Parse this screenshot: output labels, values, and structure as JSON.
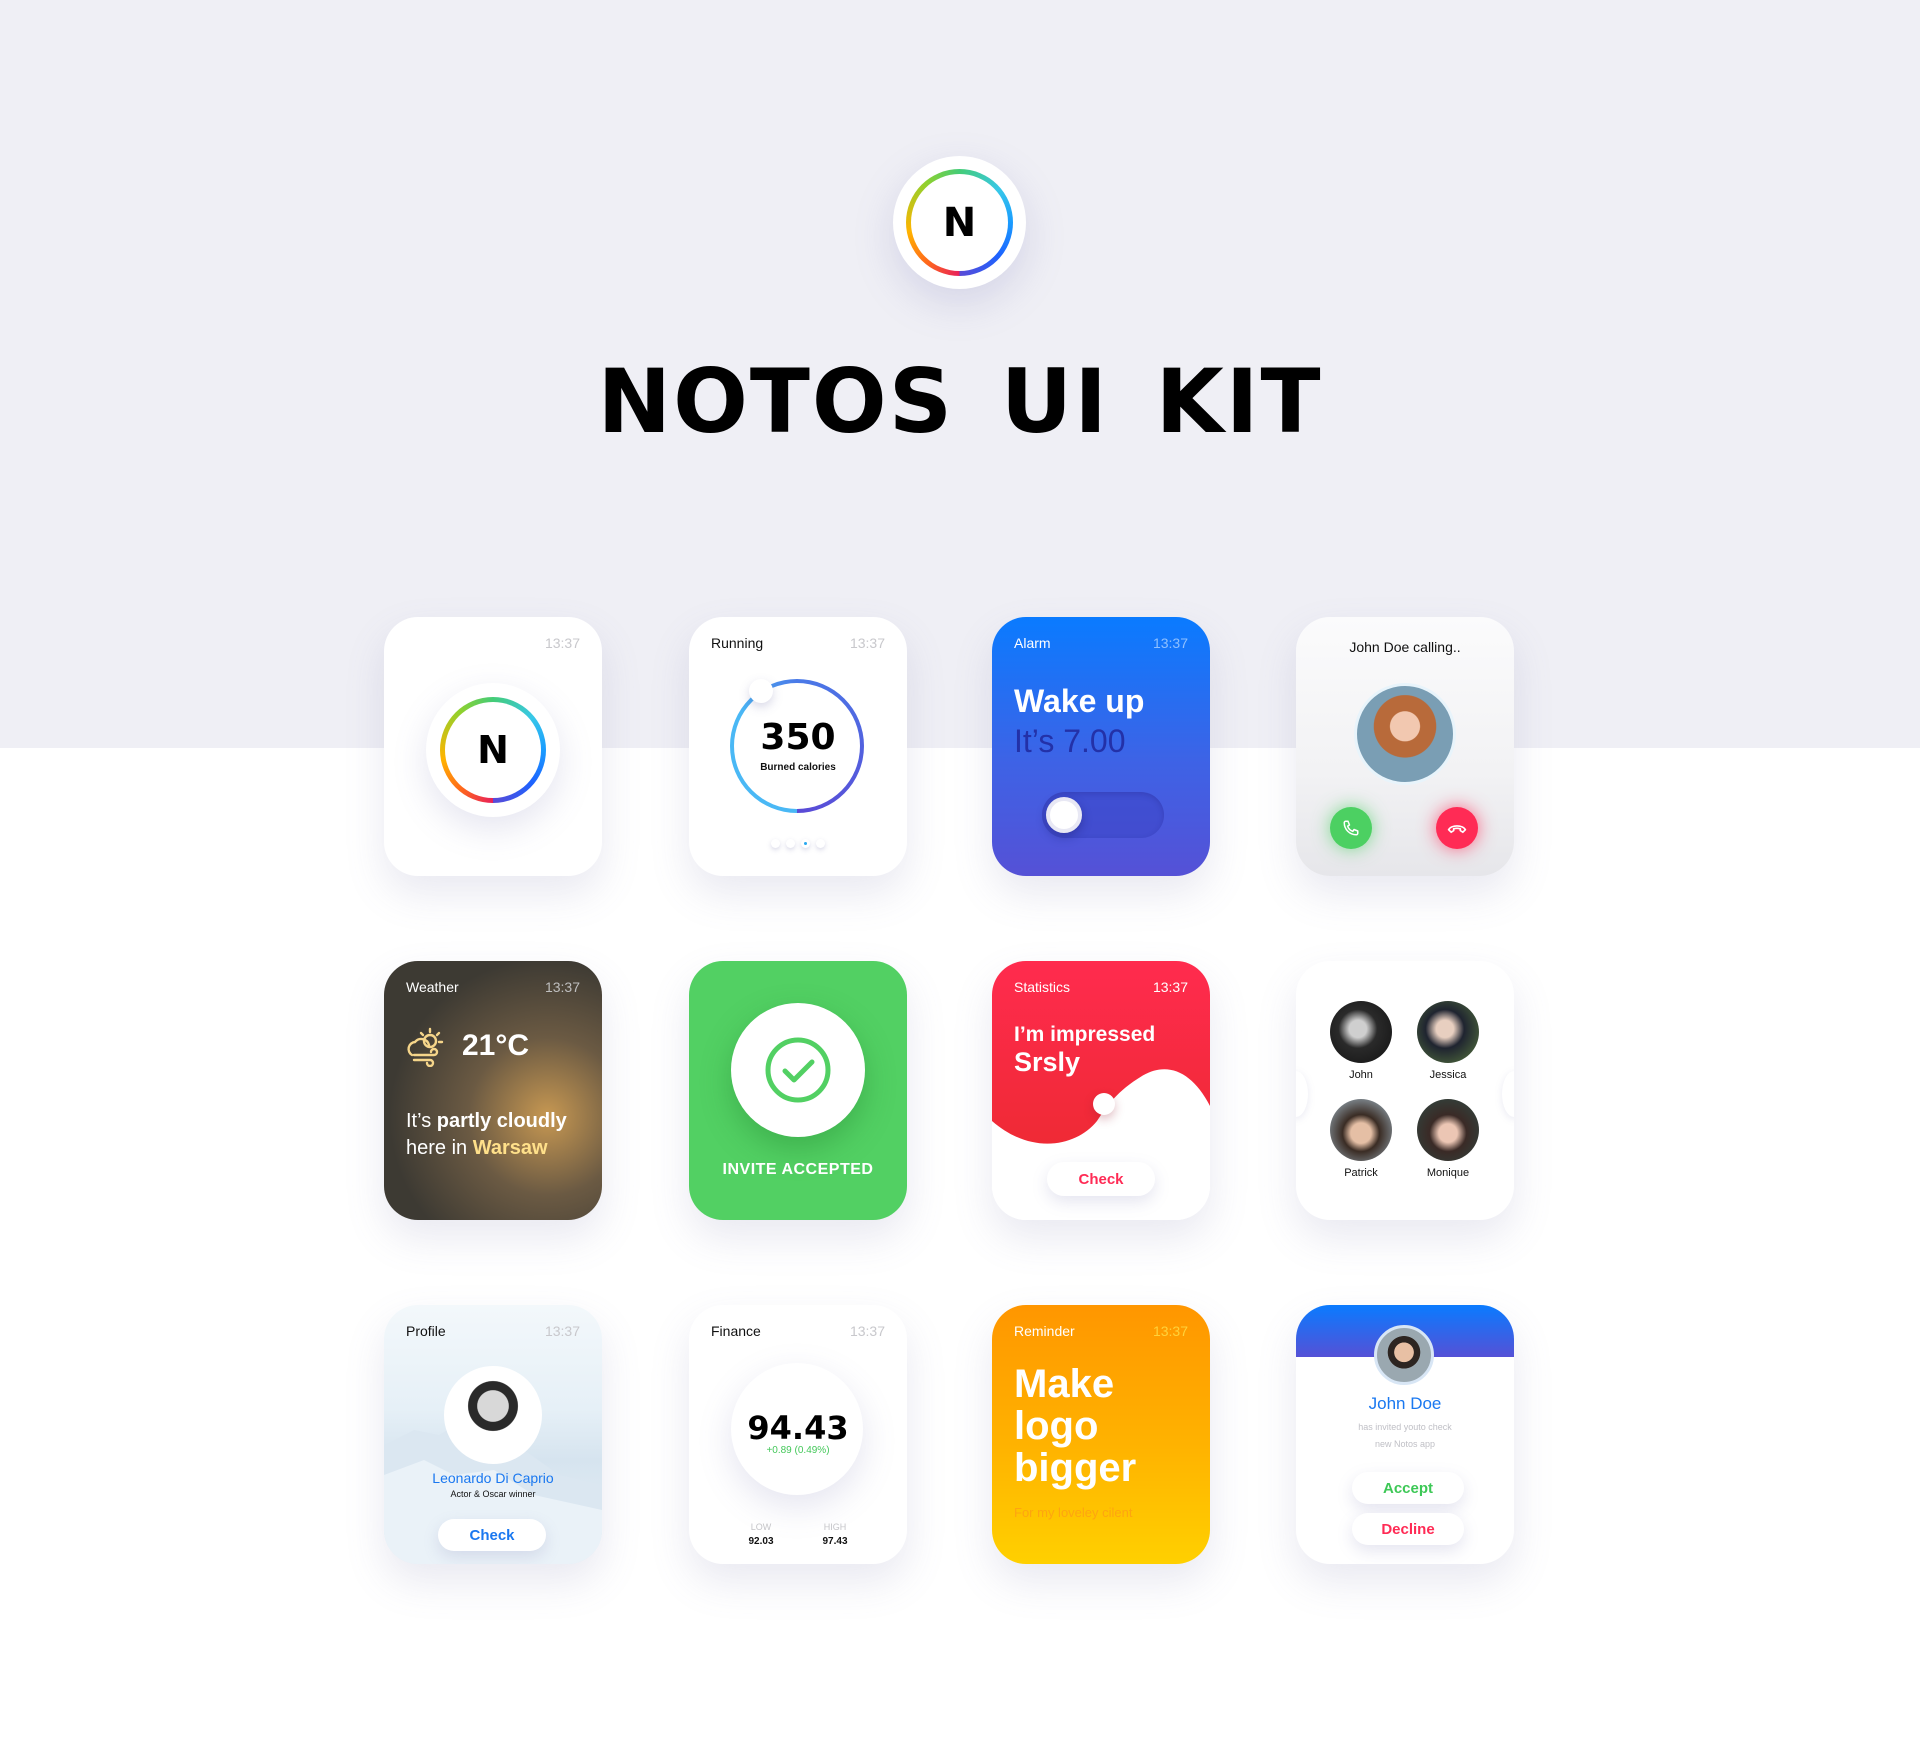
{
  "page": {
    "title": "NOTOS UI KIT",
    "logo_letter": "N"
  },
  "colors": {
    "background_top": "#efeff5",
    "background_bottom": "#ffffff",
    "blue": "#0a7bff",
    "indigo": "#5551d6",
    "green": "#52d063",
    "red": "#ff2b55",
    "orange": "#ff9600",
    "yellow": "#ffd000"
  },
  "cards": {
    "logo": {
      "time": "13:37",
      "letter": "N"
    },
    "running": {
      "title": "Running",
      "time": "13:37",
      "value": "350",
      "label": "Burned calories",
      "page_dots": 4,
      "active_dot": 3
    },
    "alarm": {
      "title": "Alarm",
      "time": "13:37",
      "line1": "Wake up",
      "line2": "It’s 7.00",
      "toggle_on": false
    },
    "call": {
      "title": "John Doe calling..",
      "accept_icon": "phone-icon",
      "decline_icon": "hang-up-icon"
    },
    "weather": {
      "title": "Weather",
      "time": "13:37",
      "icon": "partly-cloudy-windy-icon",
      "temperature": "21°C",
      "text_prefix": "It’s ",
      "text_condition": "partly cloudly",
      "text_middle": "here in ",
      "city": "Warsaw"
    },
    "invite": {
      "icon": "check-circle-icon",
      "label": "INVITE ACCEPTED"
    },
    "statistics": {
      "title": "Statistics",
      "time": "13:37",
      "line1": "I’m impressed",
      "line2": "Srsly",
      "button": "Check"
    },
    "contacts": {
      "items": [
        {
          "name": "John"
        },
        {
          "name": "Jessica"
        },
        {
          "name": "Patrick"
        },
        {
          "name": "Monique"
        }
      ]
    },
    "profile": {
      "title": "Profile",
      "time": "13:37",
      "name": "Leonardo Di Caprio",
      "role": "Actor & Oscar winner",
      "button": "Check"
    },
    "finance": {
      "title": "Finance",
      "time": "13:37",
      "value": "94.43",
      "change": "+0.89 (0.49%)",
      "low_label": "LOW",
      "low_value": "92.03",
      "high_label": "HIGH",
      "high_value": "97.43"
    },
    "reminder": {
      "title": "Reminder",
      "time": "13:37",
      "line1": "Make",
      "line2": "logo",
      "line3": "bigger",
      "subtitle": "For my loveley cilent"
    },
    "invitation": {
      "name": "John Doe",
      "desc_line1": "has invited youto check",
      "desc_line2": "new Notos app",
      "accept": "Accept",
      "decline": "Decline"
    }
  }
}
